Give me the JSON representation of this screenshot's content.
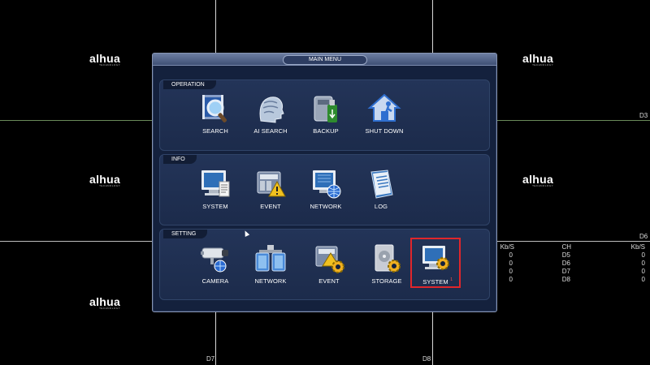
{
  "dialog": {
    "title": "MAIN MENU"
  },
  "sections": {
    "operation": {
      "title": "OPERATION",
      "items": [
        {
          "label": "SEARCH",
          "icon": "search-film-icon"
        },
        {
          "label": "AI SEARCH",
          "icon": "ai-head-icon"
        },
        {
          "label": "BACKUP",
          "icon": "backup-usb-icon"
        },
        {
          "label": "SHUT DOWN",
          "icon": "shutdown-house-icon"
        }
      ]
    },
    "info": {
      "title": "INFO",
      "items": [
        {
          "label": "SYSTEM",
          "icon": "monitor-doc-icon"
        },
        {
          "label": "EVENT",
          "icon": "event-warning-icon"
        },
        {
          "label": "NETWORK",
          "icon": "network-globe-icon"
        },
        {
          "label": "LOG",
          "icon": "log-book-icon"
        }
      ]
    },
    "setting": {
      "title": "SETTING",
      "items": [
        {
          "label": "CAMERA",
          "icon": "camera-icon"
        },
        {
          "label": "NETWORK",
          "icon": "network-gear-icon"
        },
        {
          "label": "EVENT",
          "icon": "event-gear-icon"
        },
        {
          "label": "STORAGE",
          "icon": "storage-gear-icon"
        },
        {
          "label": "SYSTEM",
          "icon": "system-gear-icon",
          "selected": true,
          "badge": "1"
        }
      ]
    }
  },
  "background": {
    "logo_text": "alhua",
    "logo_subtext": "TECHNOLOGY",
    "channel_labels": {
      "d3": "D3",
      "d6": "D6",
      "d7": "D7",
      "d8": "D8"
    },
    "stats": {
      "headers": [
        "Kb/S",
        "CH",
        "Kb/S"
      ],
      "rows": [
        [
          "0",
          "D5",
          "0"
        ],
        [
          "0",
          "D6",
          "0"
        ],
        [
          "0",
          "D7",
          "0"
        ],
        [
          "0",
          "D8",
          "0"
        ]
      ]
    }
  },
  "colors": {
    "selection": "#e0262b",
    "panel": "#14213d",
    "section": "#233458"
  }
}
